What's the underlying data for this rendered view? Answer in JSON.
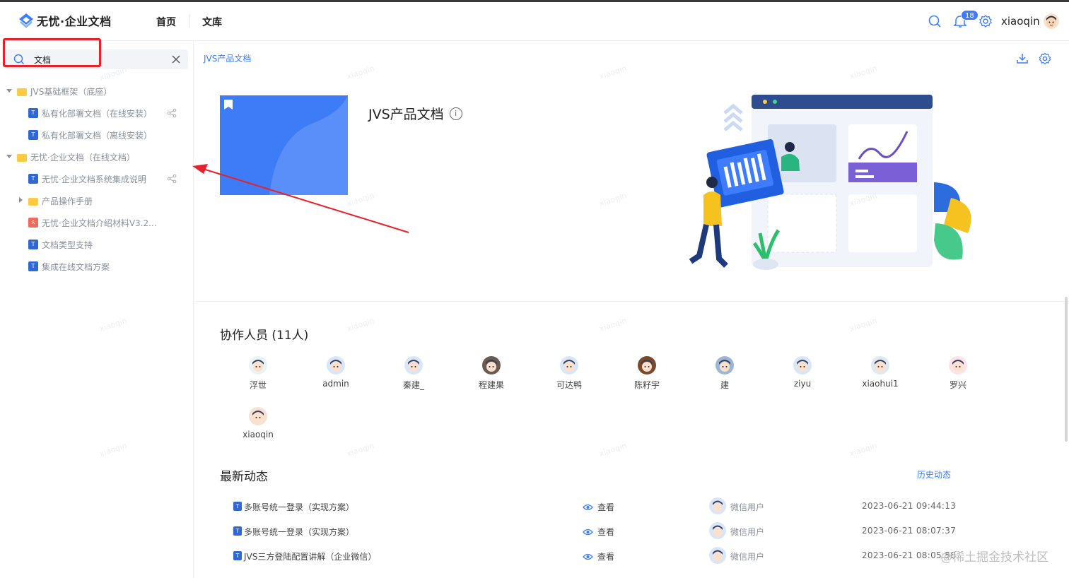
{
  "app": {
    "logo_text": "无忧·企业文档",
    "brand_color": "#3d7cff"
  },
  "header": {
    "nav": [
      "首页",
      "文库"
    ],
    "notification_count": "18",
    "username": "xiaoqin",
    "icons": [
      "search-icon",
      "bell-icon",
      "gear-icon"
    ]
  },
  "sidebar": {
    "search": {
      "value": "文档",
      "placeholder": ""
    },
    "tree": [
      {
        "label": "JVS基础框架（底座）",
        "type": "folder",
        "level": 0,
        "expanded": true
      },
      {
        "label": "私有化部署文档（在线安装）",
        "type": "doc",
        "level": 1,
        "share": true
      },
      {
        "label": "私有化部署文档（离线安装）",
        "type": "doc",
        "level": 1,
        "share": false
      },
      {
        "label": "无忧·企业文档（在线文档）",
        "type": "folder",
        "level": 0,
        "expanded": true
      },
      {
        "label": "无忧·企业文档系统集成说明",
        "type": "doc",
        "level": 1,
        "share": true
      },
      {
        "label": "产品操作手册",
        "type": "folder",
        "level": 1,
        "expanded": false
      },
      {
        "label": "无忧·企业文档介绍材料V3.2...",
        "type": "pdf",
        "level": 1,
        "share": false
      },
      {
        "label": "文档类型支持",
        "type": "doc",
        "level": 1,
        "share": false
      },
      {
        "label": "集成在线文档方案",
        "type": "doc",
        "level": 1,
        "share": false
      }
    ]
  },
  "main": {
    "breadcrumb": "JVS产品文档",
    "doc_title": "JVS产品文档",
    "collaborators_title": "协作人员 (11人)",
    "collaborators": [
      {
        "name": "浮世",
        "color": "#e9f4f6"
      },
      {
        "name": "admin",
        "color": "#d9e6fa"
      },
      {
        "name": "秦建_",
        "color": "#d9e6fa"
      },
      {
        "name": "程建果",
        "color": "#6b5a4e"
      },
      {
        "name": "可达鸭",
        "color": "#d9e6fa"
      },
      {
        "name": "陈籽宇",
        "color": "#7a4a2c"
      },
      {
        "name": "建",
        "color": "#9bb7d4"
      },
      {
        "name": "ziyu",
        "color": "#d9e6fa"
      },
      {
        "name": "xiaohui1",
        "color": "#dfe9ee"
      },
      {
        "name": "罗兴",
        "color": "#fbe3e7"
      },
      {
        "name": "xiaoqin",
        "color": "#f6e2d2"
      }
    ],
    "activity_title": "最新动态",
    "history_link": "历史动态",
    "view_label": "查看",
    "activities": [
      {
        "title": "多账号统一登录（实现方案）",
        "user": "微信用户",
        "time": "2023-06-21 09:44:13"
      },
      {
        "title": "多账号统一登录（实现方案）",
        "user": "微信用户",
        "time": "2023-06-21 08:07:37"
      },
      {
        "title": "JVS三方登陆配置讲解（企业微信）",
        "user": "微信用户",
        "time": "2023-06-21 08:05:58"
      }
    ],
    "watermark": "xiaoqin",
    "footer_mark": "@稀土掘金技术社区"
  }
}
